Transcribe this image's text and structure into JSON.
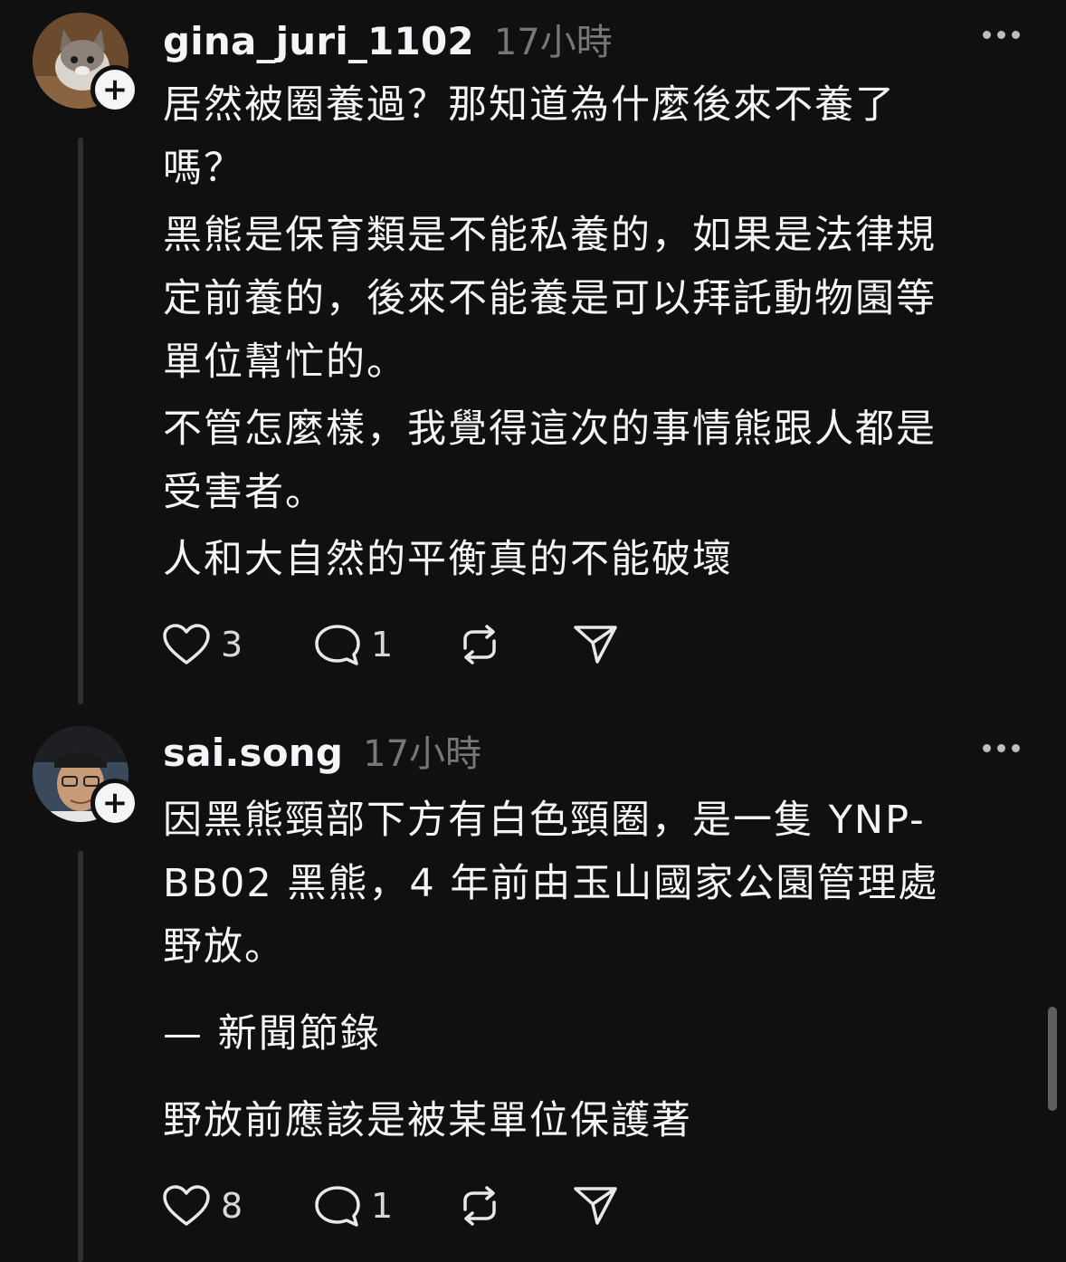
{
  "posts": [
    {
      "username": "gina_juri_1102",
      "time": "17小時",
      "lines": [
        "居然被圈養過？那知道為什麼後來不養了",
        "嗎？",
        "黑熊是保育類是不能私養的，如果是法律規",
        "定前養的，後來不能養是可以拜託動物園等",
        "單位幫忙的。",
        "不管怎麼樣，我覺得這次的事情熊跟人都是",
        "受害者。",
        "人和大自然的平衡真的不能破壞"
      ],
      "likes": "3",
      "replies": "1"
    },
    {
      "username": "sai.song",
      "time": "17小時",
      "lines": [
        "因黑熊頸部下方有白色頸圈，是一隻 YNP-",
        "BB02 黑熊，4 年前由玉山國家公園管理處",
        "野放。",
        "— 新聞節錄",
        "野放前應該是被某單位保護著"
      ],
      "likes": "8",
      "replies": "1"
    }
  ],
  "icons": {
    "like": "heart-icon",
    "reply": "comment-icon",
    "repost": "repost-icon",
    "share": "send-icon",
    "more": "more-options-icon",
    "follow": "plus-icon"
  },
  "colors": {
    "background": "#101010",
    "text": "#f3f5f7",
    "muted": "#777777"
  }
}
